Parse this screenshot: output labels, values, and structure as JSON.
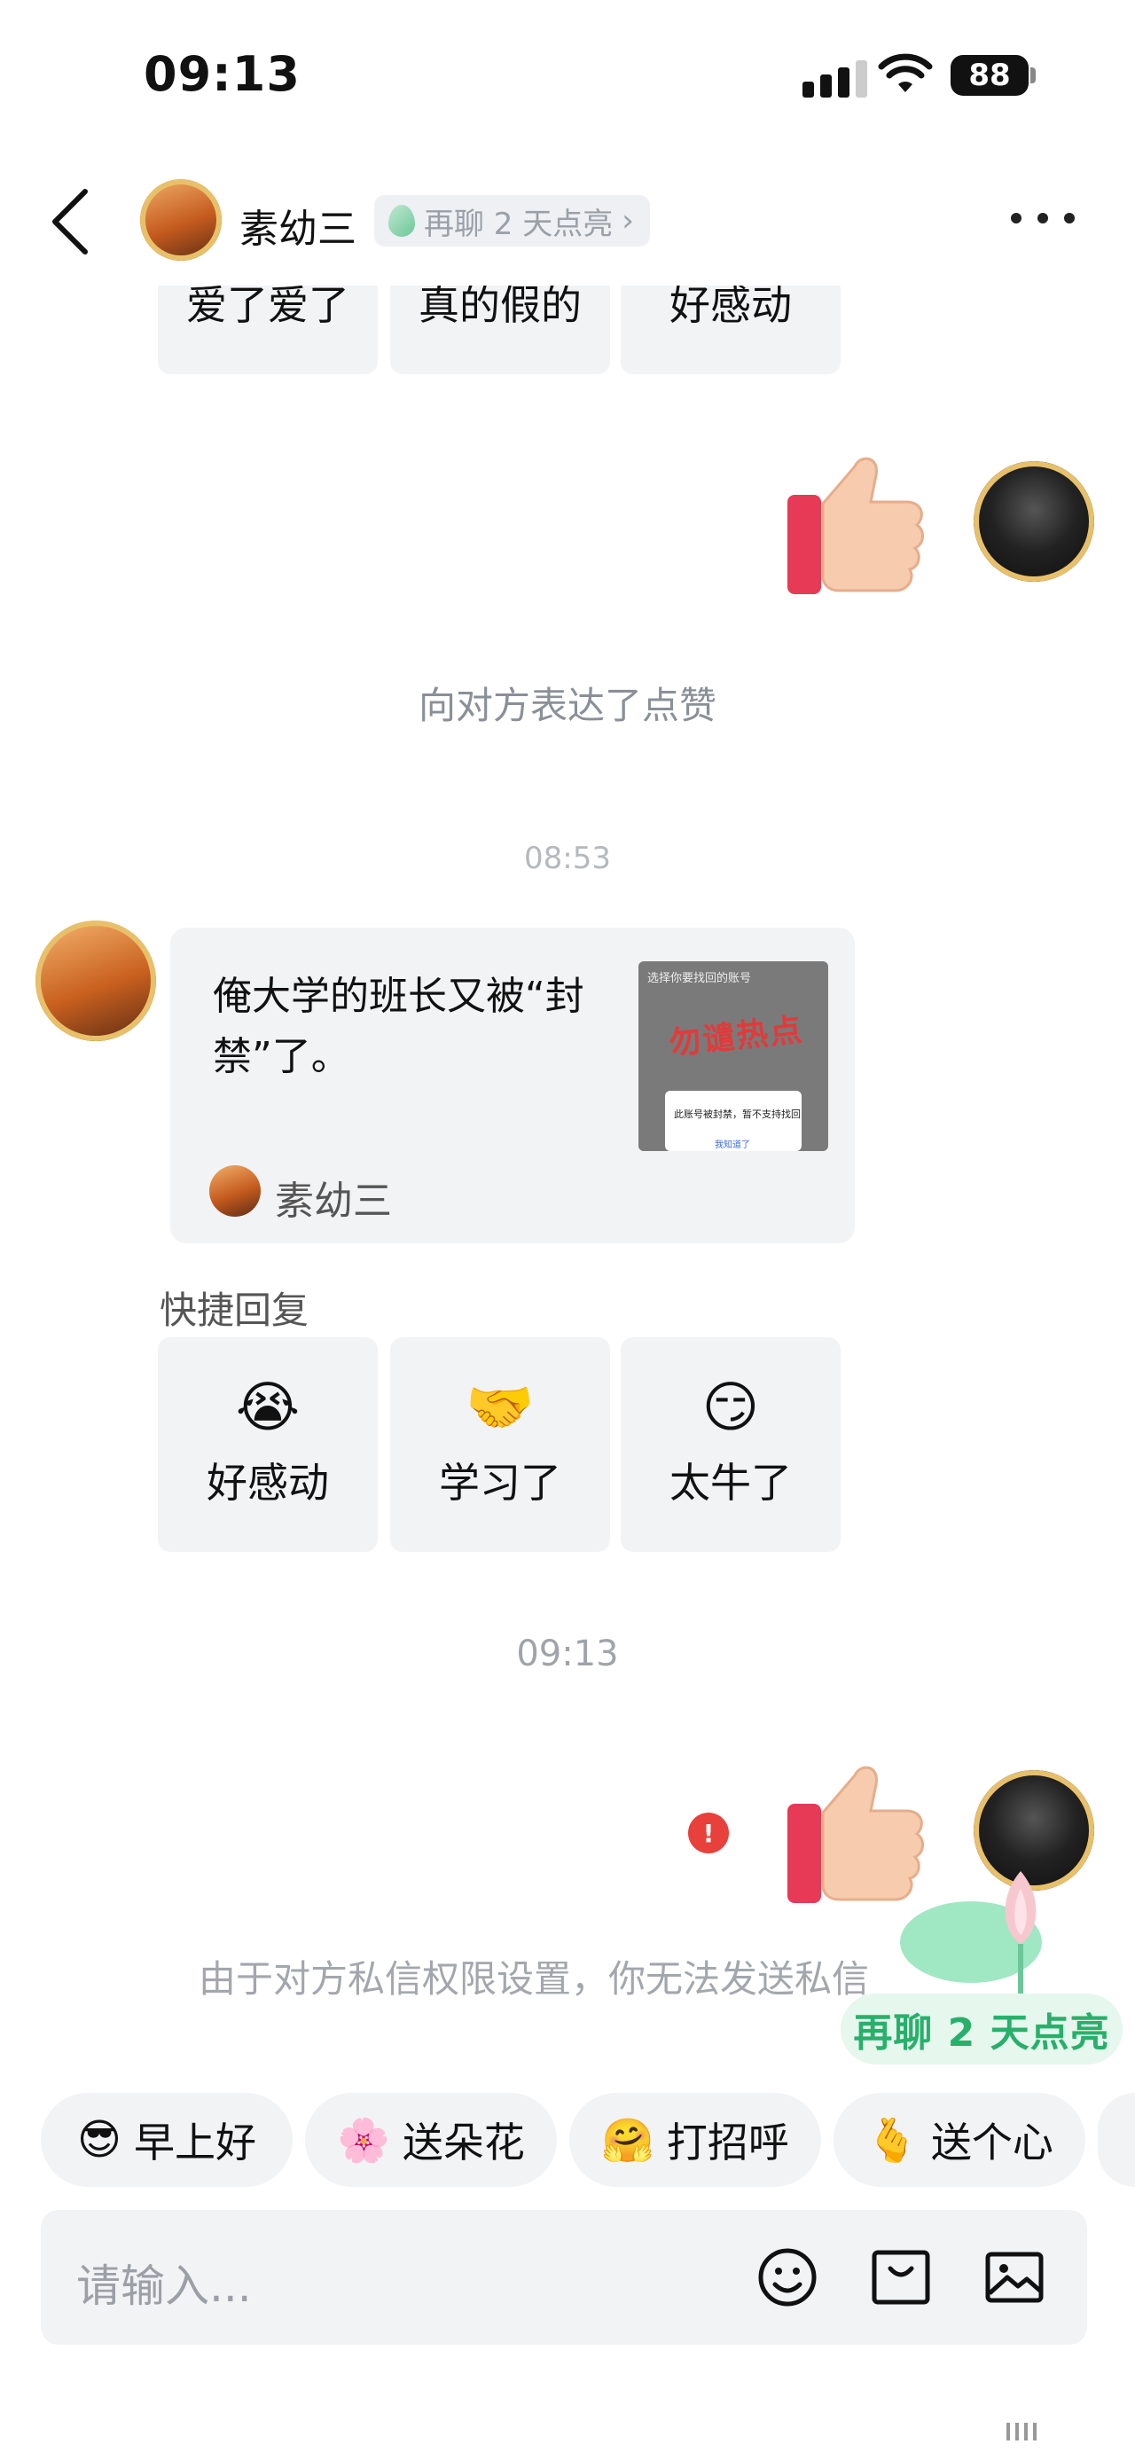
{
  "status_bar": {
    "time": "09:13",
    "battery": "88"
  },
  "header": {
    "name": "素幼三",
    "streak_pill": "再聊 2 天点亮"
  },
  "top_quick_replies": [
    "爱了爱了",
    "真的假的",
    "好感动"
  ],
  "messages": {
    "like_text": "向对方表达了点赞",
    "time_1": "08:53",
    "card_text": "俺大学的班长又被“封禁”了。",
    "card_author": "素幼三",
    "card_thumb": {
      "top_text": "选择你要找回的账号",
      "stamp": "勿谴热点",
      "dialog_text": "此账号被封禁，暂不支持找回",
      "dialog_btn": "我知道了"
    },
    "time_2": "09:13",
    "error_glyph": "!",
    "system_notice": "由于对方私信权限设置，你无法发送私信"
  },
  "quick_reply": {
    "title": "快捷回复",
    "items": [
      {
        "emoji": "😭",
        "label": "好感动"
      },
      {
        "emoji": "🤝",
        "label": "学习了"
      },
      {
        "emoji": "😏",
        "label": "太牛了"
      }
    ]
  },
  "streak_badge": "再聊 2 天点亮",
  "suggestions": [
    {
      "emoji": "😎",
      "label": "早上好"
    },
    {
      "emoji": "🌸",
      "label": "送朵花"
    },
    {
      "emoji": "🤗",
      "label": "打招呼"
    },
    {
      "emoji": "🫰",
      "label": "送个心"
    }
  ],
  "input": {
    "placeholder": "请输入..."
  },
  "icons": {
    "back": "chevron-left-icon",
    "more": "more-dots-icon",
    "like": "thumbs-up-icon",
    "error": "error-icon",
    "emoji": "smiley-icon",
    "sticker": "sticker-icon",
    "image": "image-icon"
  }
}
